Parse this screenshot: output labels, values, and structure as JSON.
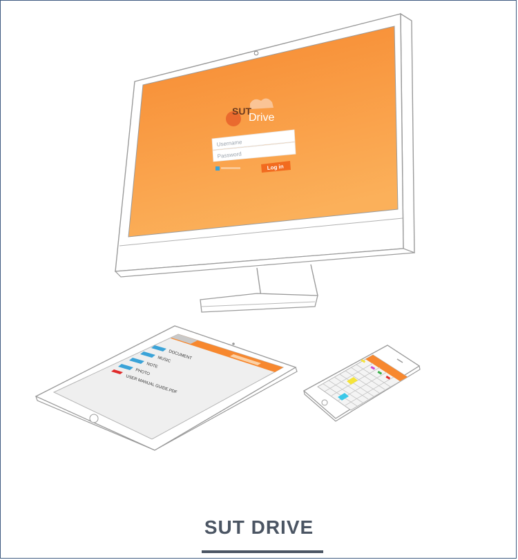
{
  "page": {
    "title": "SUT DRIVE"
  },
  "monitor": {
    "logo_sut": "SUT",
    "logo_drive": "Drive",
    "username_placeholder": "Username",
    "password_placeholder": "Password",
    "login_label": "Log in"
  },
  "tablet": {
    "files": [
      {
        "name": "DOCUMENT",
        "icon": "folder-icon"
      },
      {
        "name": "MUSIC",
        "icon": "folder-icon"
      },
      {
        "name": "NOTE",
        "icon": "folder-icon"
      },
      {
        "name": "PHOTO",
        "icon": "folder-icon"
      },
      {
        "name": "USER MANUAL GUIDE.PDF",
        "icon": "pdf-icon"
      }
    ]
  },
  "colors": {
    "accent": "#f7882f",
    "accent_light": "#fbb05a",
    "folder": "#3aa3d8",
    "pdf": "#e02b2b",
    "text": "#4b5563"
  }
}
